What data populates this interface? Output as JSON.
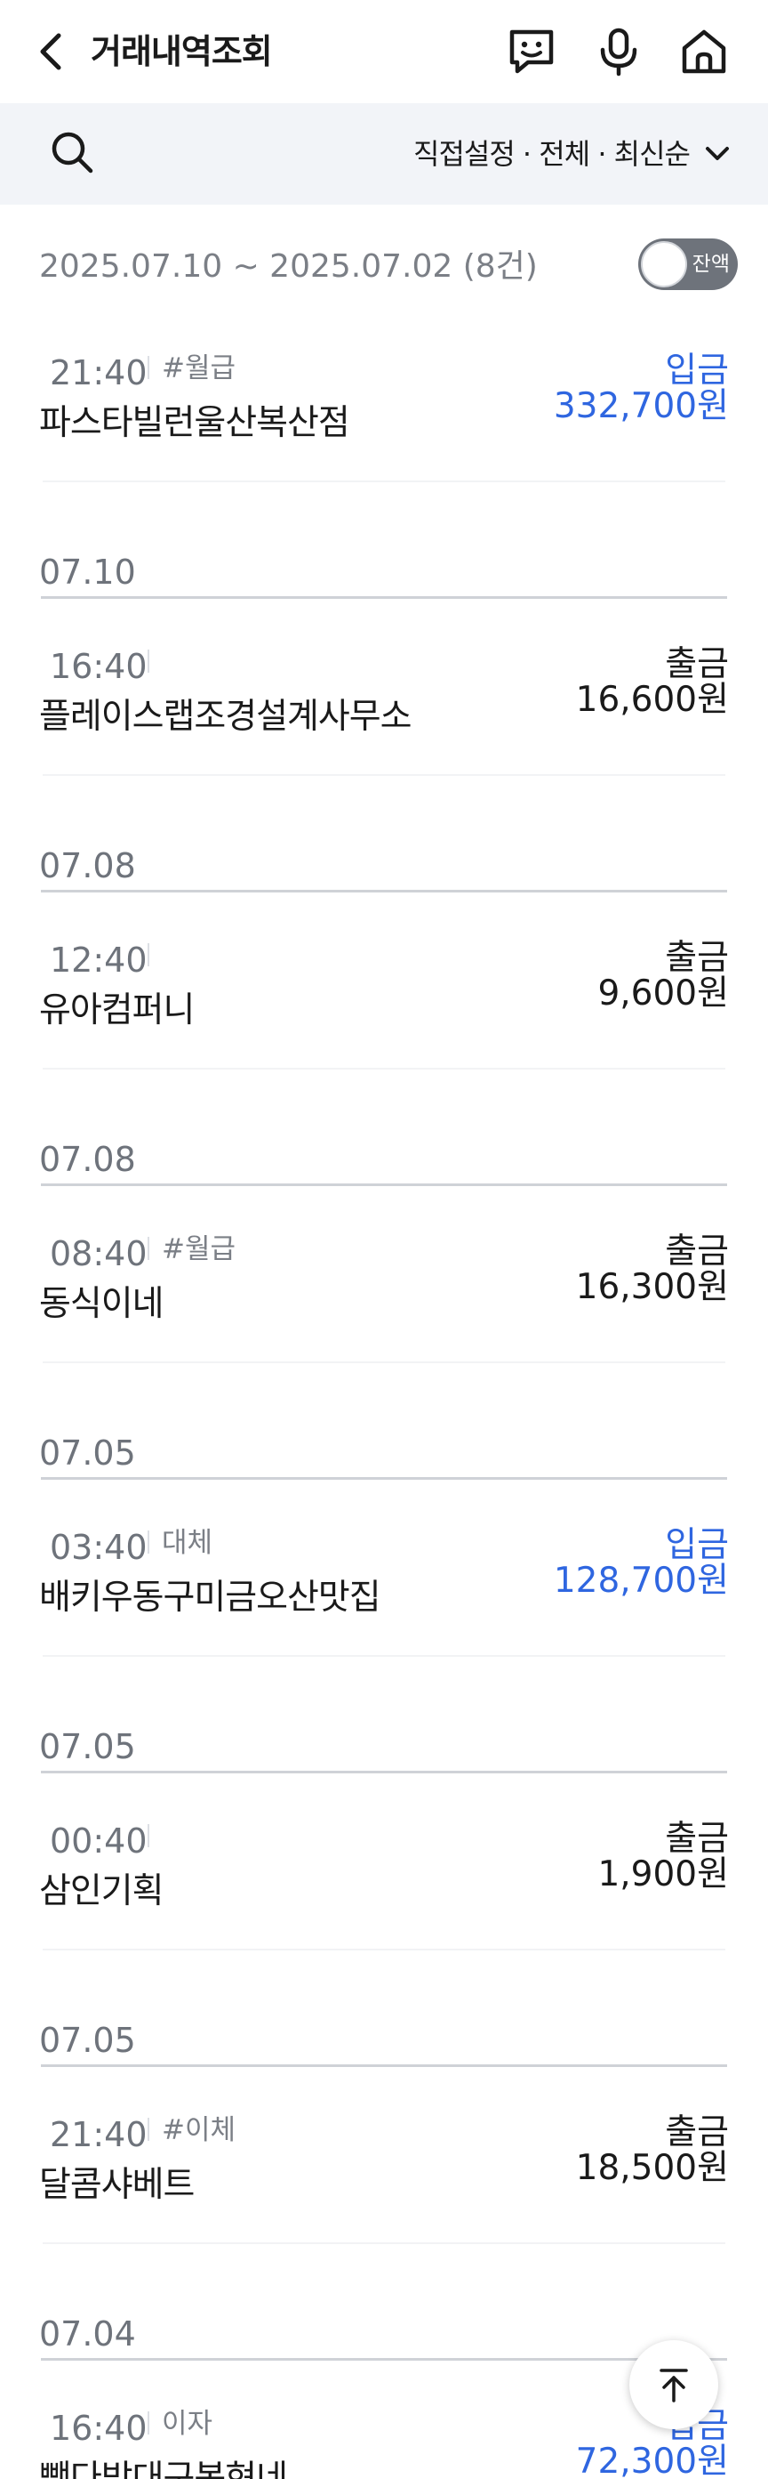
{
  "header": {
    "title": "거래내역조회"
  },
  "filter": {
    "label": "직접설정 · 전체 · 최신순"
  },
  "summary": {
    "text": "2025.07.10 ~ 2025.07.02 (8건)",
    "toggle_label": "잔액"
  },
  "groups": [
    {
      "date": "",
      "items": [
        {
          "time": "21:40",
          "memo": "#월급",
          "name": "파스타빌런울산복산점",
          "type": "입금",
          "amount": "332,700원",
          "color": "#2f66e0"
        }
      ]
    },
    {
      "date": "07.10",
      "items": [
        {
          "time": "16:40",
          "memo": "",
          "name": "플레이스랩조경설계사무소",
          "type": "출금",
          "amount": "16,600원",
          "color": "#1a1a1a"
        }
      ]
    },
    {
      "date": "07.08",
      "items": [
        {
          "time": "12:40",
          "memo": "",
          "name": "유아컴퍼니",
          "type": "출금",
          "amount": "9,600원",
          "color": "#1a1a1a"
        }
      ]
    },
    {
      "date": "07.08",
      "items": [
        {
          "time": "08:40",
          "memo": "#월급",
          "name": "동식이네",
          "type": "출금",
          "amount": "16,300원",
          "color": "#1a1a1a"
        }
      ]
    },
    {
      "date": "07.05",
      "items": [
        {
          "time": "03:40",
          "memo": "대체",
          "name": "배키우동구미금오산맛집",
          "type": "입금",
          "amount": "128,700원",
          "color": "#2f66e0"
        }
      ]
    },
    {
      "date": "07.05",
      "items": [
        {
          "time": "00:40",
          "memo": "",
          "name": "삼인기획",
          "type": "출금",
          "amount": "1,900원",
          "color": "#1a1a1a"
        }
      ]
    },
    {
      "date": "07.05",
      "items": [
        {
          "time": "21:40",
          "memo": "#이체",
          "name": "달콤샤베트",
          "type": "출금",
          "amount": "18,500원",
          "color": "#1a1a1a"
        }
      ]
    },
    {
      "date": "07.04",
      "items": [
        {
          "time": "16:40",
          "memo": "이자",
          "name": "빽다방대구봉현네",
          "type": "입금",
          "amount": "72,300원",
          "color": "#2f66e0"
        }
      ]
    }
  ],
  "icons": {
    "back": "chevron-left-icon",
    "chat": "chatbot-icon",
    "mic": "microphone-icon",
    "home": "home-icon",
    "search": "search-icon",
    "dropdown": "chevron-down-icon",
    "scroll_top": "arrow-up-icon"
  }
}
